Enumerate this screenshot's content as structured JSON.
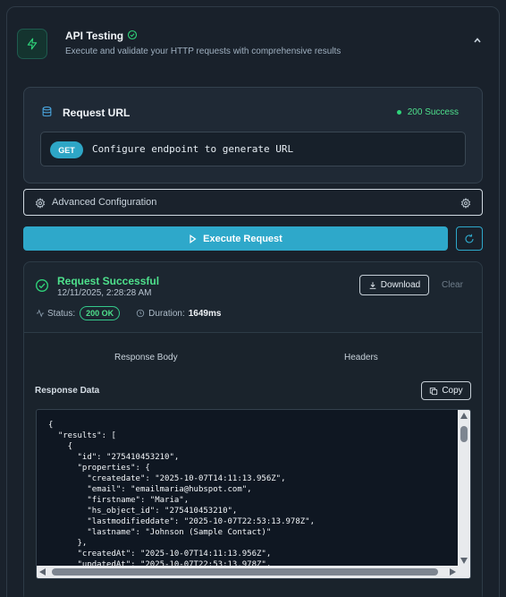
{
  "header": {
    "title": "API Testing",
    "subtitle": "Execute and validate your HTTP requests with comprehensive results",
    "accent": "#2fd47a"
  },
  "request_url": {
    "title": "Request URL",
    "status": "200 Success",
    "method": "GET",
    "url_text": "Configure endpoint to generate URL"
  },
  "advanced": {
    "label": "Advanced Configuration"
  },
  "execute": {
    "label": "Execute Request",
    "color": "#2ea8ca"
  },
  "result": {
    "title": "Request Successful",
    "timestamp": "12/11/2025, 2:28:28 AM",
    "download_label": "Download",
    "clear_label": "Clear",
    "status_label": "Status:",
    "status_value": "200 OK",
    "duration_label": "Duration:",
    "duration_value": "1649ms"
  },
  "tabs": {
    "body": "Response Body",
    "headers": "Headers"
  },
  "response": {
    "label": "Response Data",
    "copy_label": "Copy",
    "code_lines": [
      "{",
      "  \"results\": [",
      "    {",
      "      \"id\": \"275410453210\",",
      "      \"properties\": {",
      "        \"createdate\": \"2025-10-07T14:11:13.956Z\",",
      "        \"email\": \"emailmaria@hubspot.com\",",
      "        \"firstname\": \"Maria\",",
      "        \"hs_object_id\": \"275410453210\",",
      "        \"lastmodifieddate\": \"2025-10-07T22:53:13.978Z\",",
      "        \"lastname\": \"Johnson (Sample Contact)\"",
      "      },",
      "      \"createdAt\": \"2025-10-07T14:11:13.956Z\",",
      "      \"updatedAt\": \"2025-10-07T22:53:13.978Z\","
    ]
  }
}
